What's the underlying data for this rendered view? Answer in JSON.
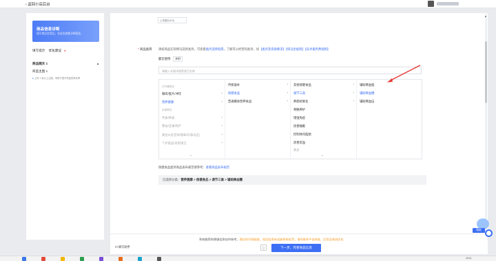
{
  "topbar": {
    "back_label": "‹ 返回小店后台"
  },
  "sidebar": {
    "diag_title": "商品信息诊断",
    "diag_subtitle": "填写商品信息后，在此处查看诊断报告",
    "tabs": [
      "填写提示",
      "优化建议"
    ],
    "section_title": "商品图文",
    "section_count": "1",
    "sub_item": "商品主图",
    "sub_count": "1",
    "hint": "上传 1 张以上主图，有助于提升商品的转化率"
  },
  "form": {
    "upload_label": "上传图片(0/3)",
    "category_label": "商品类目",
    "category_rules_prefix": "请按商品实际情况选择类目，可查看",
    "category_rules_link1": "类目选择指南",
    "category_rules_mid": "，了解可以经营的类目，如",
    "category_rules_link2": "【类目及资质要求】",
    "category_rules_link3": "【保证金规则】",
    "category_rules_link4": "【技术服务费规则】",
    "recent_label": "最近使用:",
    "recent_tag": "护肝",
    "search_placeholder": "请输入关键词搜索类目名称",
    "col1_group1": "已开通类目",
    "col1_items": [
      "咖啡/麦片/冲饮",
      "营养健康"
    ],
    "col1_group2": "全部类目",
    "col1_more": [
      "手表/钟表",
      "零食/坚果/特产",
      "黄金/K金首饰/翡翠/珍珠/钻石",
      "个护家居/日用清洁"
    ],
    "col2_items": [
      "传统滋补",
      "保健食品",
      "普通膳食营养食品"
    ],
    "col3_items": [
      "其他保健食品",
      "调节三高",
      "养颜抗氧化",
      "骨骼养护",
      "增强免疫",
      "改善睡眠",
      "控制体内脂肪",
      "改善贫血",
      "更多"
    ],
    "col4_items": [
      "辅助降血脂",
      "辅助降血糖",
      "辅助降血压"
    ],
    "note_prefix": "保健食品类目商品发布规范请参考：",
    "note_link": "查看商品发布规范",
    "path_prefix": "已选择分类：",
    "path_value": "营养健康 > 保健食品 > 调节三高 > 辅助降血糖"
  },
  "bottom": {
    "hint_prefix": "系统推荐和预填信息仅供参考，",
    "hint_warn": "建议你仔细核查，如因信息有误被系统处罚，请你联系平台核查，后续会改进优化",
    "expert_label": "填写助手",
    "preview_label": "预览",
    "next_label": "下一步，完善商品信息"
  },
  "help": {
    "label": "帮助"
  },
  "taskbar": {
    "time": "10:11"
  },
  "colors": {
    "accent": "#3d6ff5",
    "warn": "#f59a23",
    "annotation_arrow": "#e53935"
  }
}
